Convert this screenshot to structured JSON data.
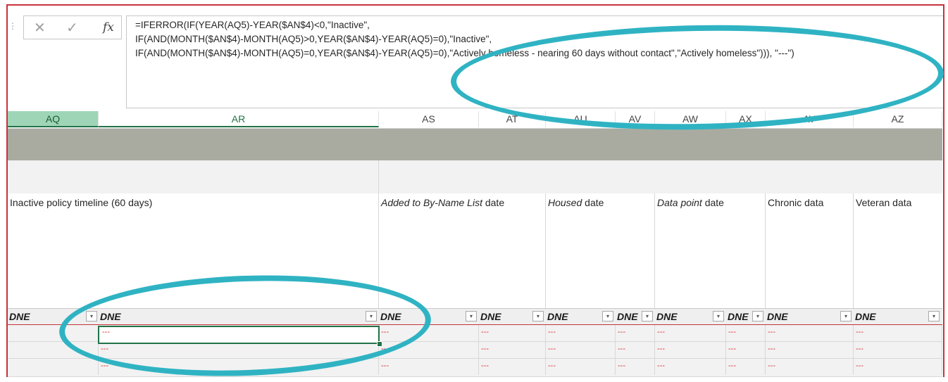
{
  "formula_bar": {
    "cancel_icon": "✕",
    "enter_icon": "✓",
    "fx_label": "fx",
    "lines": [
      "=IFERROR(IF(YEAR(AQ5)-YEAR($AN$4)<0,\"Inactive\",",
      "IF(AND(MONTH($AN$4)-MONTH(AQ5)>0,YEAR($AN$4)-YEAR(AQ5)=0),\"Inactive\",",
      "IF(AND(MONTH($AN$4)-MONTH(AQ5)=0,YEAR($AN$4)-YEAR(AQ5)=0),\"Actively homeless - nearing 60 days without contact\",\"Actively homeless\"))), \"---\")"
    ]
  },
  "columns": [
    "AQ",
    "AR",
    "AS",
    "AT",
    "AU",
    "AV",
    "AW",
    "AX",
    "AY",
    "AZ"
  ],
  "headers": {
    "ar": "Inactive policy timeline (60 days)",
    "as_italic": "Added to By-Name List",
    "as_rest": " date",
    "au_italic": "Housed",
    "au_rest": " date",
    "aw_italic": "Data point",
    "aw_rest": " date",
    "ay": "Chronic data",
    "az": "Veteran data"
  },
  "filter_label": "DNE",
  "filter_icon": "▾",
  "placeholder": "---",
  "colors": {
    "selection": "#217346",
    "circle": "#2fb3c3",
    "border": "#c8323b",
    "dash_text": "#e0353b"
  }
}
